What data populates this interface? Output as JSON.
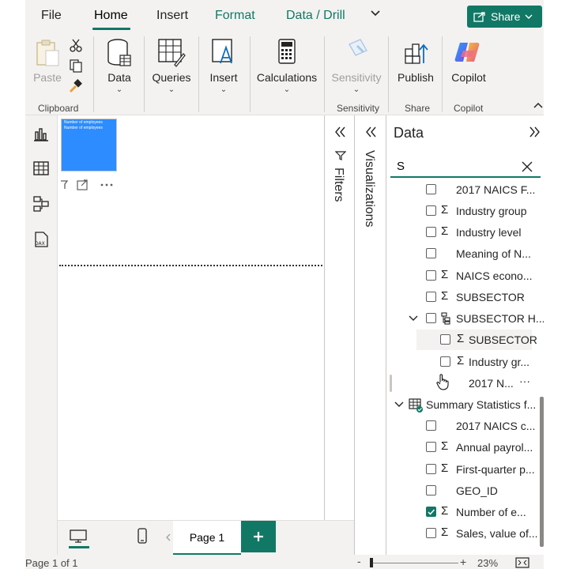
{
  "tabs": [
    "File",
    "Home",
    "Insert",
    "Format",
    "Data / Drill"
  ],
  "share_label": "Share",
  "ribbon": {
    "paste": "Paste",
    "data": "Data",
    "queries": "Queries",
    "insert": "Insert",
    "calculations": "Calculations",
    "sensitivity": "Sensitivity",
    "publish": "Publish",
    "copilot": "Copilot",
    "groups": {
      "clipboard": "Clipboard",
      "sensitivity": "Sensitivity",
      "share": "Share",
      "copilot": "Copilot"
    }
  },
  "visual": {
    "title": "Number of employees",
    "subtitle": "Number of employees"
  },
  "panes": {
    "filters": "Filters",
    "visualizations": "Visualizations",
    "data": "Data"
  },
  "search": {
    "value": "S"
  },
  "fields": [
    {
      "label": "2017 NAICS F...",
      "sigma": false,
      "checked": false,
      "indent": 0
    },
    {
      "label": "Industry group",
      "sigma": true,
      "checked": false,
      "indent": 0
    },
    {
      "label": "Industry level",
      "sigma": true,
      "checked": false,
      "indent": 0
    },
    {
      "label": "Meaning of N...",
      "sigma": false,
      "checked": false,
      "indent": 0
    },
    {
      "label": "NAICS econo...",
      "sigma": true,
      "checked": false,
      "indent": 0
    },
    {
      "label": "SUBSECTOR",
      "sigma": true,
      "checked": false,
      "indent": 0
    },
    {
      "label": "SUBSECTOR H...",
      "sigma": false,
      "checked": false,
      "indent": 0,
      "hierarchy": true
    },
    {
      "label": "SUBSECTOR",
      "sigma": true,
      "checked": false,
      "indent": 1
    },
    {
      "label": "Industry gr...",
      "sigma": true,
      "checked": false,
      "indent": 1
    },
    {
      "label": "2017 N...",
      "sigma": false,
      "checked": false,
      "indent": 2
    },
    {
      "label": "Summary Statistics f...",
      "table": true
    },
    {
      "label": "2017 NAICS c...",
      "sigma": false,
      "checked": false,
      "indent": 0
    },
    {
      "label": "Annual payrol...",
      "sigma": true,
      "checked": false,
      "indent": 0
    },
    {
      "label": "First-quarter p...",
      "sigma": true,
      "checked": false,
      "indent": 0
    },
    {
      "label": "GEO_ID",
      "sigma": false,
      "checked": false,
      "indent": 0
    },
    {
      "label": "Number of e...",
      "sigma": true,
      "checked": true,
      "indent": 0
    },
    {
      "label": "Sales, value of...",
      "sigma": true,
      "checked": false,
      "indent": 0
    }
  ],
  "page_tab": "Page 1",
  "status": {
    "page": "Page 1 of 1",
    "zoom": "23%"
  }
}
